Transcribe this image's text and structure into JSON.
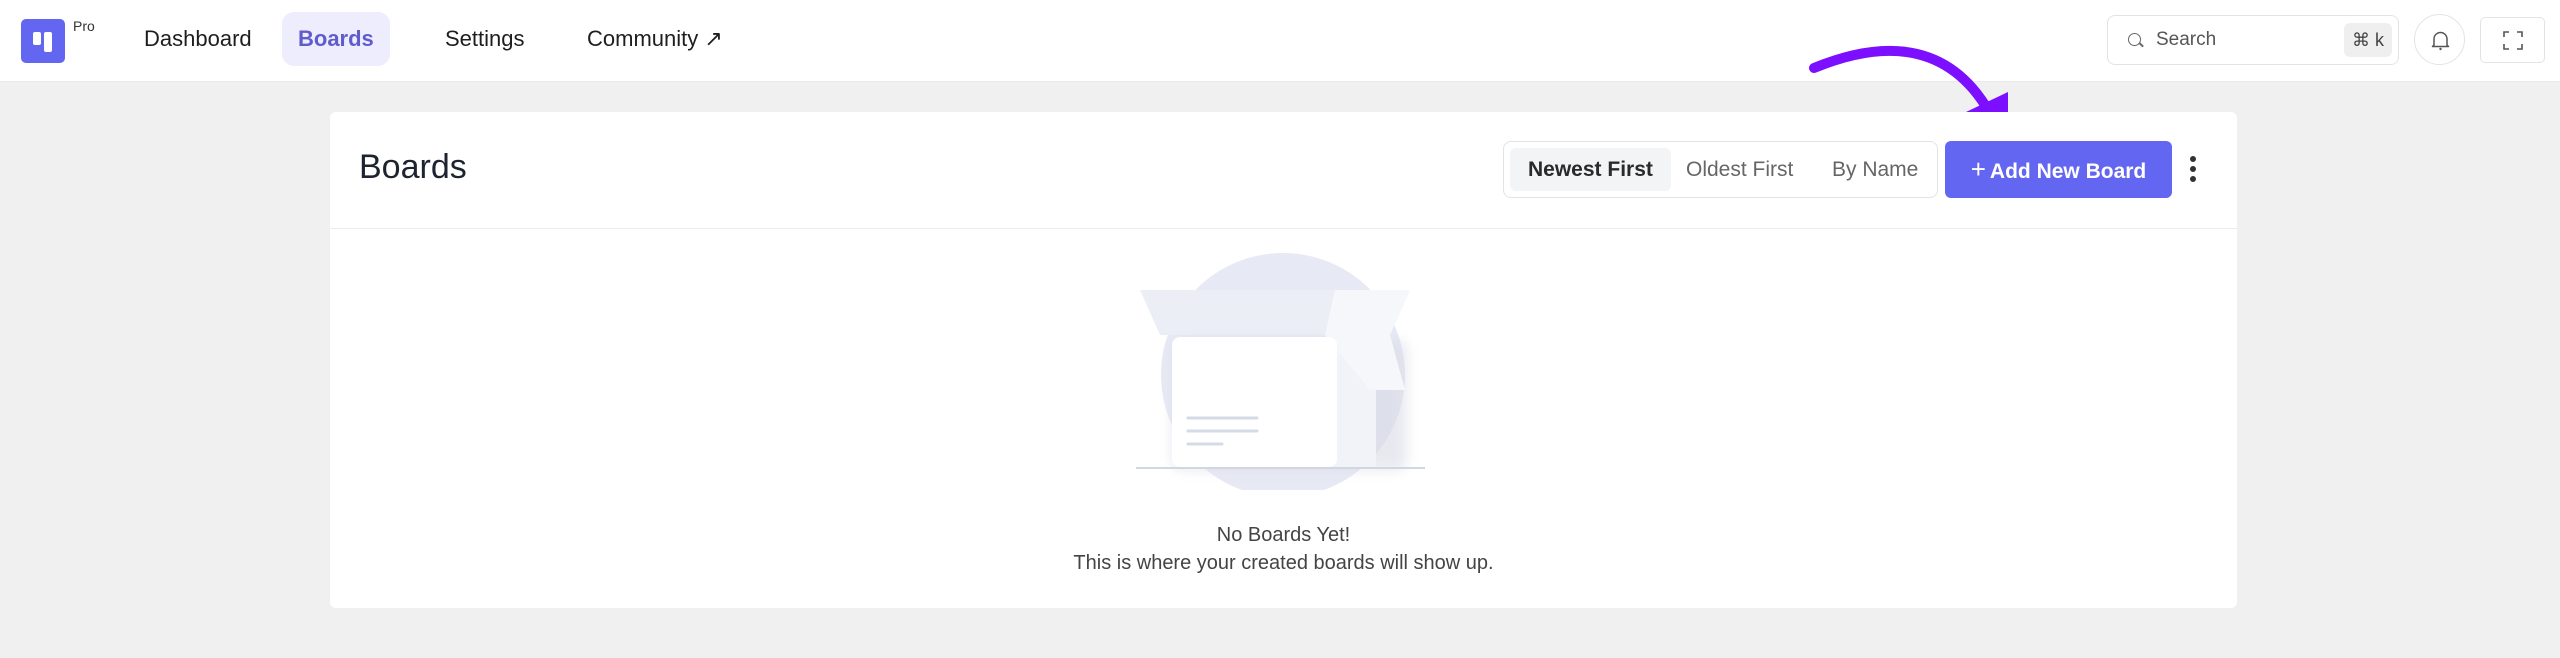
{
  "app": {
    "logo_badge": "Pro",
    "brand_color": "#6366f1"
  },
  "nav": {
    "items": [
      {
        "label": "Dashboard",
        "active": false
      },
      {
        "label": "Boards",
        "active": true
      },
      {
        "label": "Settings",
        "active": false
      },
      {
        "label": "Community ↗",
        "active": false
      }
    ]
  },
  "search": {
    "placeholder": "Search",
    "shortcut": "⌘ k"
  },
  "page": {
    "title": "Boards",
    "sort_options": [
      {
        "label": "Newest First",
        "active": true
      },
      {
        "label": "Oldest First",
        "active": false
      },
      {
        "label": "By Name",
        "active": false
      }
    ],
    "add_button": {
      "icon": "+",
      "label": "Add New Board"
    },
    "empty_state": {
      "title": "No Boards Yet!",
      "description": "This is where your created boards will show up."
    }
  },
  "annotation": {
    "arrow_color": "#7c0fff",
    "target": "add-new-board-button"
  }
}
